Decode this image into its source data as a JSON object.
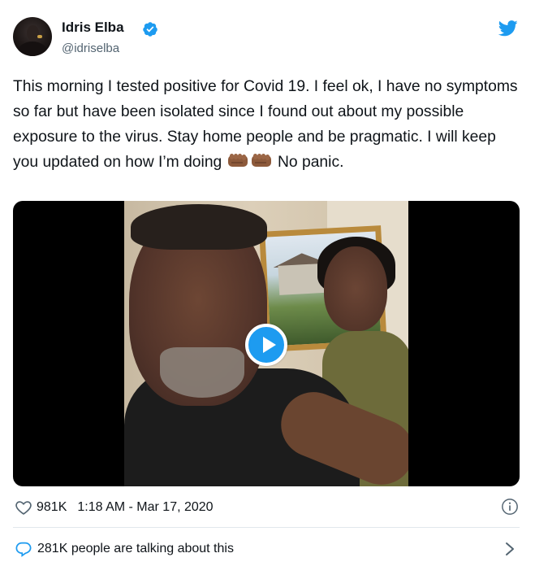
{
  "author": {
    "name": "Idris Elba",
    "handle": "@idriselba"
  },
  "tweet": {
    "text_before_emoji": "This morning I tested positive for Covid 19. I feel ok, I have no symptoms so far but have been isolated since I found out about my possible exposure to the virus.  Stay home people and be pragmatic. I will keep you updated on how I’m doing ",
    "emoji": "👊🏾👊🏾",
    "text_after_emoji": " No panic."
  },
  "media": {
    "type": "video",
    "play_icon": "play-icon"
  },
  "meta": {
    "likes": "981K",
    "timestamp": "1:18 AM - Mar 17, 2020"
  },
  "footer": {
    "talking_text": "281K people are talking about this"
  },
  "colors": {
    "accent": "#1d9bf0",
    "text": "#0f1419",
    "muted": "#536471",
    "divider": "#e1e8ed"
  },
  "icons": [
    "verified-icon",
    "twitter-logo-icon",
    "heart-icon",
    "info-icon",
    "speech-bubble-icon",
    "chevron-right-icon",
    "play-icon"
  ]
}
